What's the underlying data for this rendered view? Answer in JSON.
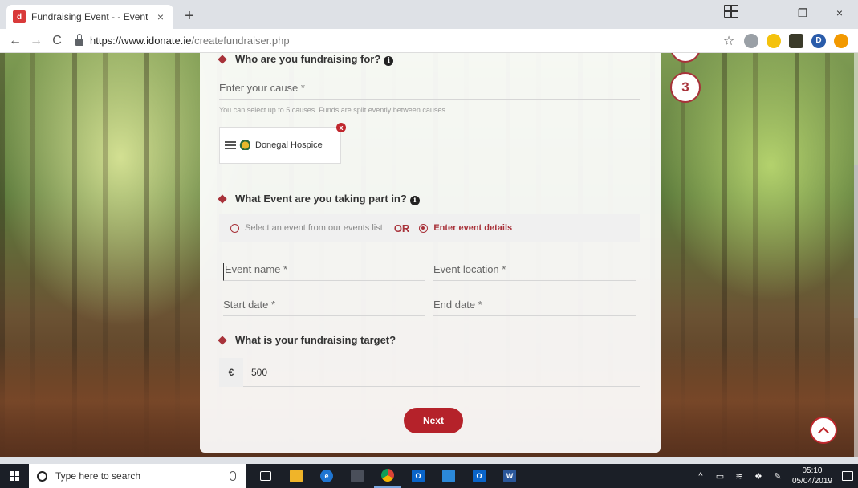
{
  "browser": {
    "tab_title": "Fundraising Event - - Event Chari",
    "favicon_letter": "d",
    "new_tab_symbol": "+",
    "close_symbol": "×",
    "url_host": "https://www.idonate.ie",
    "url_path": "/createfundraiser.php",
    "back_symbol": "←",
    "forward_symbol": "→",
    "reload_symbol": "C",
    "star_symbol": "☆",
    "minimize_symbol": "–",
    "restore_symbol": "❐",
    "window_close_symbol": "×",
    "profile_letter": "D"
  },
  "page": {
    "step_number": "3",
    "cause_section": {
      "heading": "Who are you fundraising for?",
      "input_placeholder": "Enter your cause *",
      "helper": "You can select up to 5 causes. Funds are split evently between causes.",
      "selected_cause": "Donegal Hospice",
      "remove_symbol": "x"
    },
    "event_section": {
      "heading": "What Event are you taking part in?",
      "option_list": "Select an event from our events list",
      "or_text": "OR",
      "option_details": "Enter event details",
      "selected_option": "Enter event details",
      "event_name_placeholder": "Event name *",
      "event_location_placeholder": "Event location *",
      "start_date_placeholder": "Start date *",
      "end_date_placeholder": "End date *"
    },
    "target_section": {
      "heading": "What is your fundraising target?",
      "currency": "€",
      "amount": "500"
    },
    "next_label": "Next"
  },
  "taskbar": {
    "search_placeholder": "Type here to search",
    "time": "05:10",
    "date": "05/04/2019"
  },
  "colors": {
    "brand": "#a8323a",
    "button": "#b5222a",
    "taskbar": "#1b1f27"
  }
}
